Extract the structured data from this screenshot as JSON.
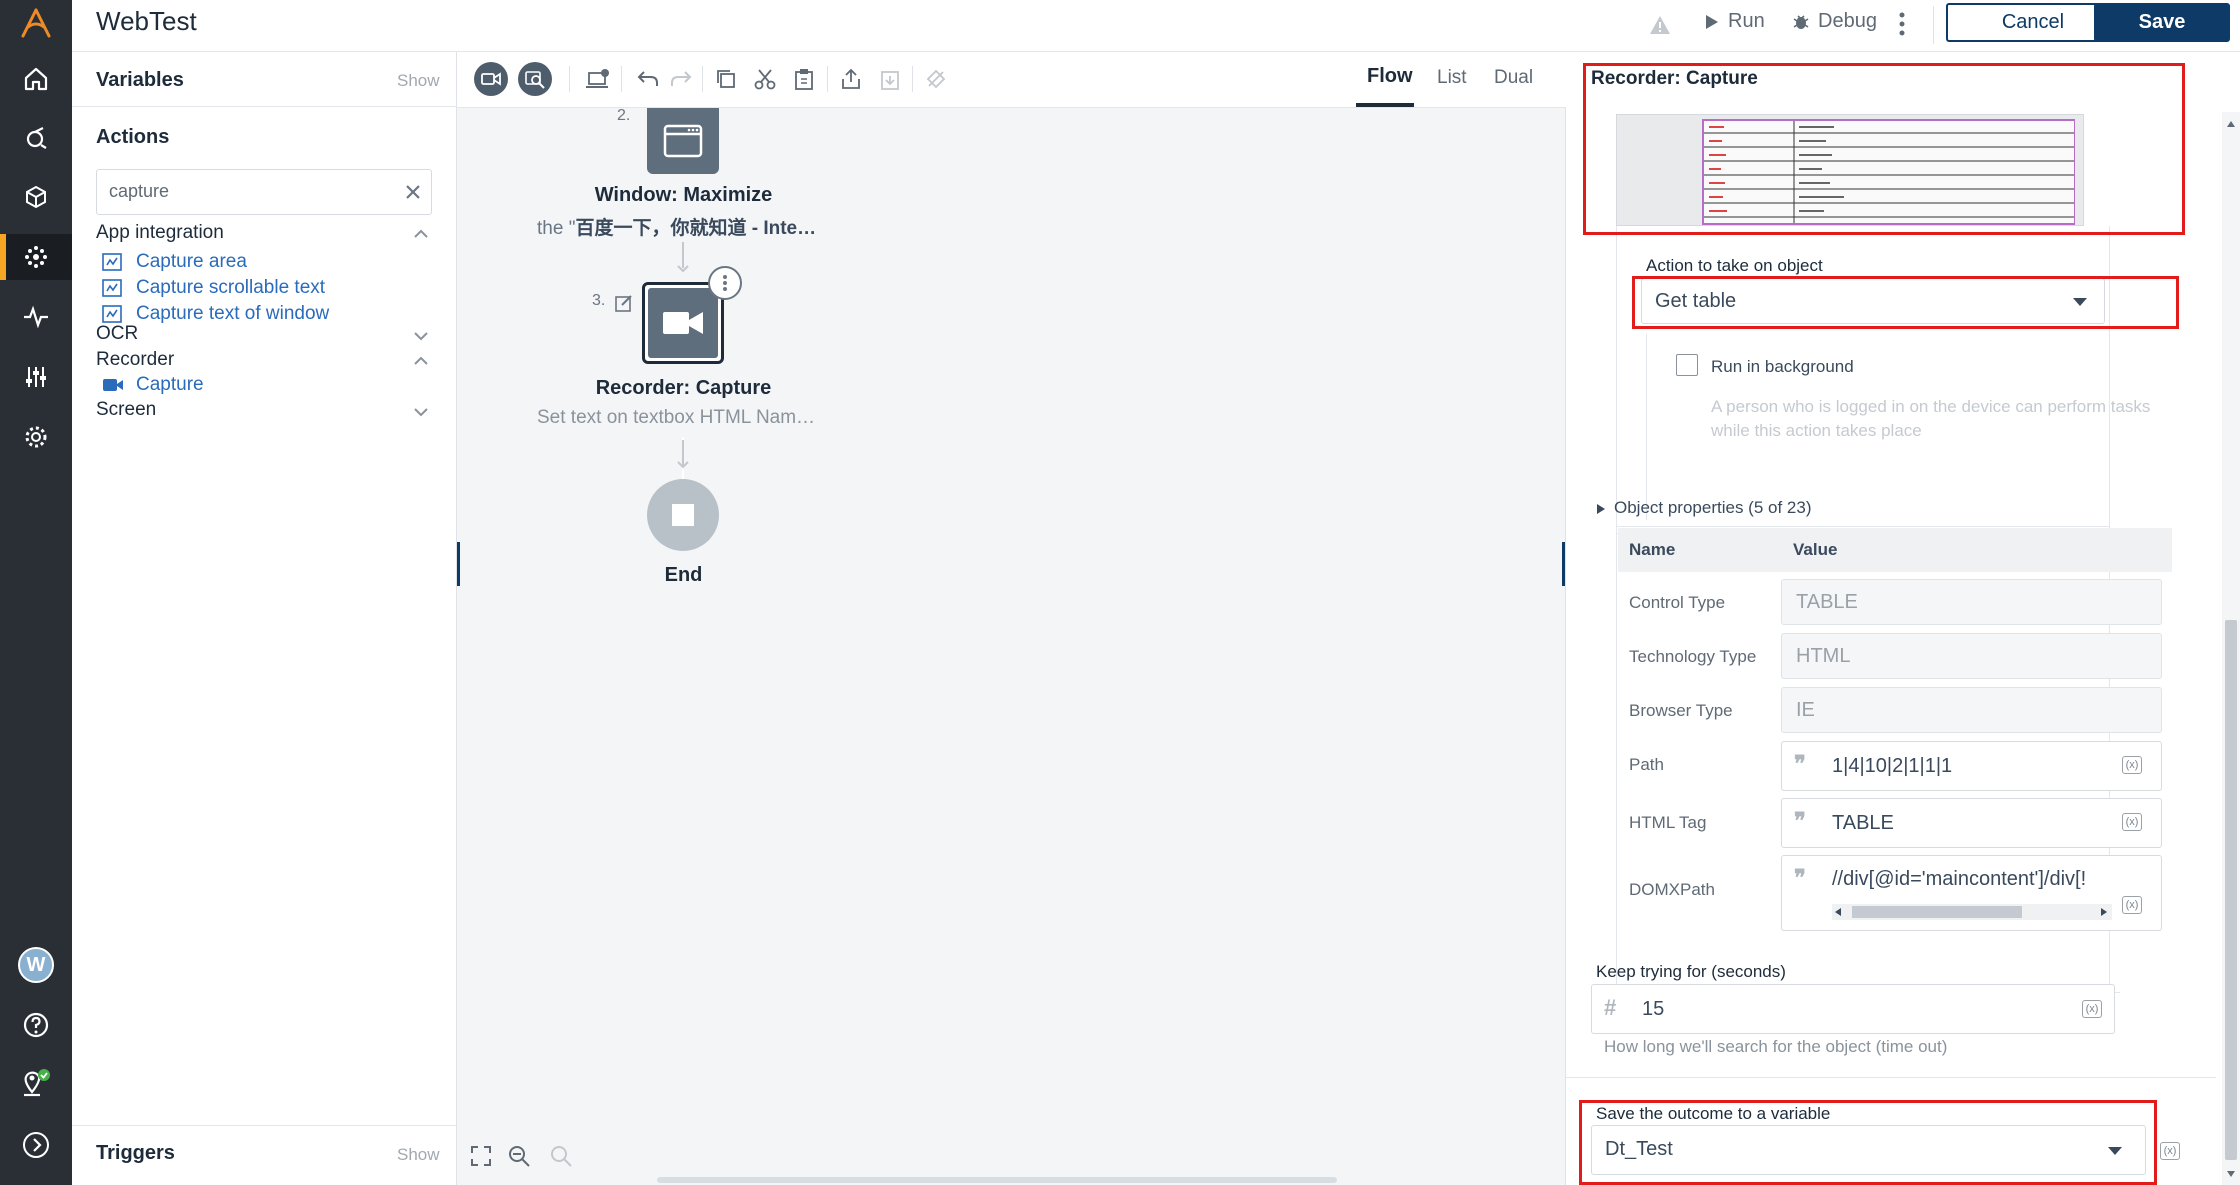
{
  "app": {
    "title": "WebTest"
  },
  "header": {
    "run_label": "Run",
    "debug_label": "Debug",
    "cancel_label": "Cancel",
    "save_label": "Save"
  },
  "nav": {
    "items": [
      "logo-icon",
      "home-icon",
      "bot-icon",
      "cube-icon",
      "automation-icon",
      "activity-icon",
      "sliders-icon",
      "settings-icon"
    ],
    "avatar_letter": "W"
  },
  "left_panel": {
    "variables_title": "Variables",
    "variables_show": "Show",
    "actions_title": "Actions",
    "search_value": "capture",
    "groups": [
      {
        "label": "App integration",
        "expanded": true,
        "items": [
          "Capture area",
          "Capture scrollable text",
          "Capture text of window"
        ]
      },
      {
        "label": "OCR",
        "expanded": false,
        "items": []
      },
      {
        "label": "Recorder",
        "expanded": true,
        "items": [
          "Capture"
        ]
      },
      {
        "label": "Screen",
        "expanded": false,
        "items": []
      }
    ],
    "triggers_title": "Triggers",
    "triggers_show": "Show"
  },
  "canvas": {
    "tabs": [
      "Flow",
      "List",
      "Dual"
    ],
    "active_tab": "Flow",
    "nodes": [
      {
        "step": "2.",
        "title": "Window: Maximize",
        "desc_prefix": "the \"",
        "desc_bold": "百度一下，你就知道 - Inte…"
      },
      {
        "step": "3.",
        "title": "Recorder: Capture",
        "desc": "Set text on textbox HTML Nam…"
      },
      {
        "title": "End"
      }
    ]
  },
  "right_panel": {
    "title": "Recorder: Capture",
    "action_label": "Action to take on object",
    "action_value": "Get table",
    "run_in_background": "Run in background",
    "run_in_background_checked": false,
    "background_help": "A person who is logged in on the device can perform tasks while this action takes place",
    "object_props_label": "Object properties (5 of 23)",
    "table_headers": [
      "Name",
      "Value"
    ],
    "props": [
      {
        "name": "Control Type",
        "value": "TABLE"
      },
      {
        "name": "Technology Type",
        "value": "HTML"
      },
      {
        "name": "Browser Type",
        "value": "IE"
      },
      {
        "name": "Path",
        "value": "1|4|10|2|1|1|1"
      },
      {
        "name": "HTML Tag",
        "value": "TABLE"
      },
      {
        "name": "DOMXPath",
        "value": "//div[@id='maincontent']/div[!"
      }
    ],
    "keep_trying_label": "Keep trying for (seconds)",
    "keep_trying_value": "15",
    "keep_trying_help": "How long we'll search for the object (time out)",
    "save_outcome_label": "Save the outcome to a variable",
    "save_outcome_value": "Dt_Test",
    "var_tag": "(x)"
  },
  "colors": {
    "accent": "#0d3a66",
    "nav_bg": "#2a2f36",
    "active_nav": "#f5a623",
    "highlight": "#e21b1b",
    "link": "#2a6bbb"
  }
}
